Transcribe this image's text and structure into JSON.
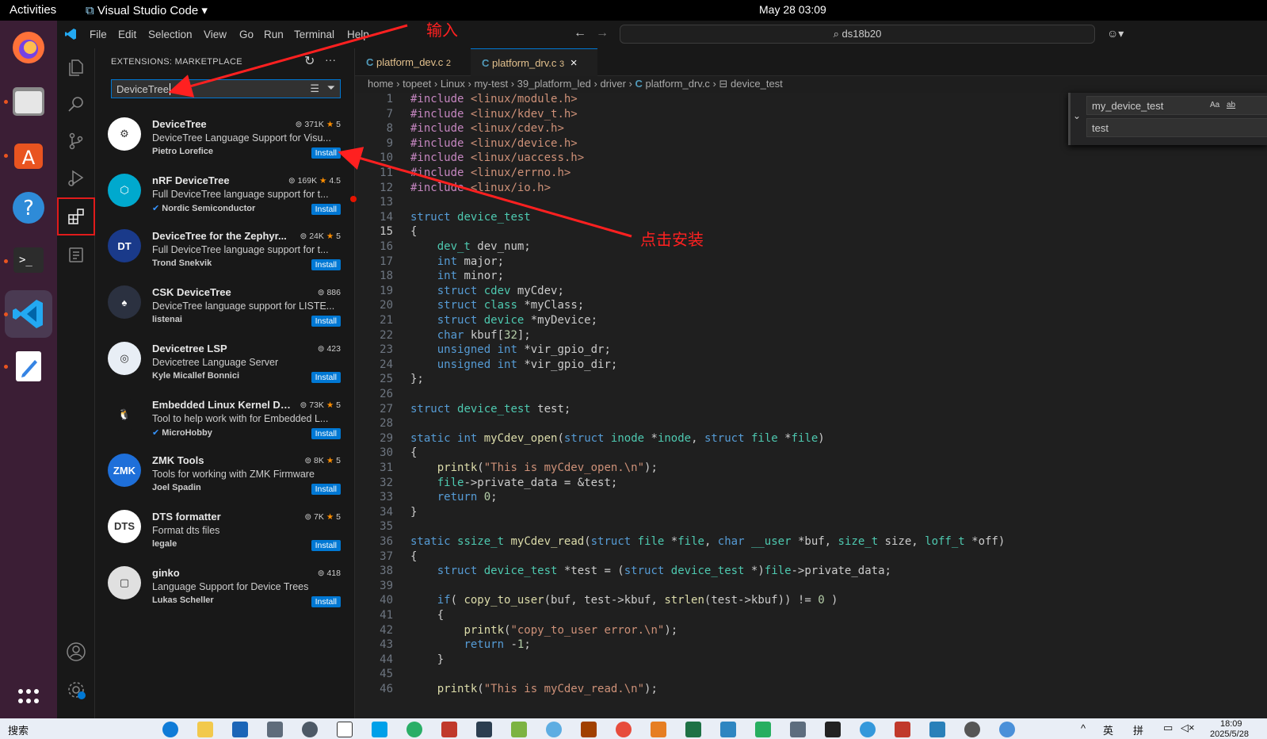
{
  "os": {
    "activities": "Activities",
    "app_name": "Visual Studio Code",
    "clock": "May 28  03:09"
  },
  "menu": [
    "File",
    "Edit",
    "Selection",
    "View",
    "Go",
    "Run",
    "Terminal",
    "Help"
  ],
  "command_center": "ds18b20",
  "sidebar": {
    "title": "EXTENSIONS: MARKETPLACE",
    "search_value": "DeviceTree",
    "extensions": [
      {
        "name": "DeviceTree",
        "downloads": "371K",
        "rating": "5",
        "desc": "DeviceTree Language Support for Visu...",
        "publisher": "Pietro Lorefice",
        "install": "Install",
        "color": "#ffffff"
      },
      {
        "name": "nRF DeviceTree",
        "downloads": "169K",
        "rating": "4.5",
        "desc": "Full DeviceTree language support for t...",
        "publisher": "Nordic Semiconductor",
        "install": "Install",
        "color": "#00a9ce"
      },
      {
        "name": "DeviceTree for the Zephyr...",
        "downloads": "24K",
        "rating": "5",
        "desc": "Full DeviceTree language support for t...",
        "publisher": "Trond Snekvik",
        "install": "Install",
        "color": "#1a3a8a"
      },
      {
        "name": "CSK DeviceTree",
        "downloads": "886",
        "rating": "",
        "desc": "DeviceTree language support for LISTE...",
        "publisher": "listenai",
        "install": "Install",
        "color": "#2b3140"
      },
      {
        "name": "Devicetree LSP",
        "downloads": "423",
        "rating": "",
        "desc": "Devicetree Language Server",
        "publisher": "Kyle Micallef Bonnici",
        "install": "Install",
        "color": "#e8eef5"
      },
      {
        "name": "Embedded Linux Kernel Dev",
        "downloads": "73K",
        "rating": "5",
        "desc": "Tool to help work with for Embedded L...",
        "publisher": "MicroHobby",
        "install": "Install",
        "color": "#181818"
      },
      {
        "name": "ZMK Tools",
        "downloads": "8K",
        "rating": "5",
        "desc": "Tools for working with ZMK Firmware",
        "publisher": "Joel Spadin",
        "install": "Install",
        "color": "#1e6fd9"
      },
      {
        "name": "DTS formatter",
        "downloads": "7K",
        "rating": "5",
        "desc": "Format dts files",
        "publisher": "legale",
        "install": "Install",
        "color": "#ffffff"
      },
      {
        "name": "ginko",
        "downloads": "418",
        "rating": "",
        "desc": "Language Support for Device Trees",
        "publisher": "Lukas Scheller",
        "install": "Install",
        "color": "#e0e0e0"
      }
    ]
  },
  "tabs": [
    {
      "label": "platform_dev.c",
      "badge": "2"
    },
    {
      "label": "platform_drv.c",
      "badge": "3",
      "close": "×"
    }
  ],
  "breadcrumb": [
    "home",
    "topeet",
    "Linux",
    "my-test",
    "39_platform_led",
    "driver",
    "platform_drv.c",
    "device_test"
  ],
  "find_widget": {
    "find": "my_device_test",
    "replace": "test"
  },
  "annotations": {
    "input": "输入",
    "install": "点击安装"
  },
  "taskbar": {
    "search": "搜索",
    "time": "18:09",
    "date": "2025/5/28",
    "ime1": "英",
    "ime2": "拼"
  },
  "code": [
    [
      "1",
      "#include <linux/module.h>"
    ],
    [
      "7",
      "#include <linux/kdev_t.h>"
    ],
    [
      "8",
      "#include <linux/cdev.h>"
    ],
    [
      "9",
      "#include <linux/device.h>"
    ],
    [
      "10",
      "#include <linux/uaccess.h>"
    ],
    [
      "11",
      "#include <linux/errno.h>"
    ],
    [
      "12",
      "#include <linux/io.h>"
    ],
    [
      "13",
      ""
    ],
    [
      "14",
      "struct device_test"
    ],
    [
      "15",
      "{"
    ],
    [
      "16",
      "    dev_t dev_num;"
    ],
    [
      "17",
      "    int major;"
    ],
    [
      "18",
      "    int minor;"
    ],
    [
      "19",
      "    struct cdev myCdev;"
    ],
    [
      "20",
      "    struct class *myClass;"
    ],
    [
      "21",
      "    struct device *myDevice;"
    ],
    [
      "22",
      "    char kbuf[32];"
    ],
    [
      "23",
      "    unsigned int *vir_gpio_dr;"
    ],
    [
      "24",
      "    unsigned int *vir_gpio_dir;"
    ],
    [
      "25",
      "};"
    ],
    [
      "26",
      ""
    ],
    [
      "27",
      "struct device_test test;"
    ],
    [
      "28",
      ""
    ],
    [
      "29",
      "static int myCdev_open(struct inode *inode, struct file *file)"
    ],
    [
      "30",
      "{"
    ],
    [
      "31",
      "    printk(\"This is myCdev_open.\\n\");"
    ],
    [
      "32",
      "    file->private_data = &test;"
    ],
    [
      "33",
      "    return 0;"
    ],
    [
      "34",
      "}"
    ],
    [
      "35",
      ""
    ],
    [
      "36",
      "static ssize_t myCdev_read(struct file *file, char __user *buf, size_t size, loff_t *off)"
    ],
    [
      "37",
      "{"
    ],
    [
      "38",
      "    struct device_test *test = (struct device_test *)file->private_data;"
    ],
    [
      "39",
      ""
    ],
    [
      "40",
      "    if( copy_to_user(buf, test->kbuf, strlen(test->kbuf)) != 0 )"
    ],
    [
      "41",
      "    {"
    ],
    [
      "42",
      "        printk(\"copy_to_user error.\\n\");"
    ],
    [
      "43",
      "        return -1;"
    ],
    [
      "44",
      "    }"
    ],
    [
      "45",
      ""
    ],
    [
      "46",
      "    printk(\"This is myCdev_read.\\n\");"
    ]
  ]
}
